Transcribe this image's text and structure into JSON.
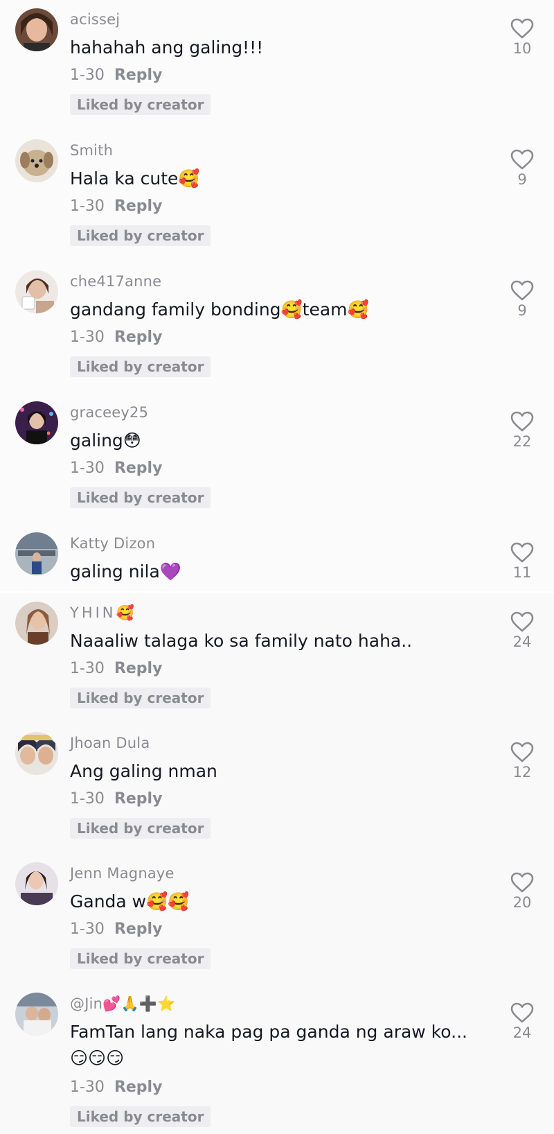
{
  "comments": [
    {
      "username": "acissej",
      "text": "hahahah ang galing!!!",
      "date": "1-30",
      "reply": "Reply",
      "badge": "Liked by creator",
      "likes": "10",
      "avatar_color": "#6b4a3a"
    },
    {
      "username": "Smith",
      "text": "Hala ka cute🥰",
      "date": "1-30",
      "reply": "Reply",
      "badge": "Liked by creator",
      "likes": "9",
      "avatar_color": "#c9b08f"
    },
    {
      "username": "che417anne",
      "text": "gandang family bonding🥰team🥰",
      "date": "1-30",
      "reply": "Reply",
      "badge": "Liked by creator",
      "likes": "9",
      "avatar_color": "#d8c7c0"
    },
    {
      "username": "graceey25",
      "text": "galing😳",
      "date": "1-30",
      "reply": "Reply",
      "badge": "Liked by creator",
      "likes": "22",
      "avatar_color": "#3a1f4a"
    },
    {
      "username": "Katty Dizon",
      "text": "galing nila💜",
      "likes": "11",
      "avatar_color": "#6f7f8f"
    },
    {
      "username": "YHIN🥰",
      "text": "Naaaliw talaga ko sa family nato haha..",
      "date": "1-30",
      "reply": "Reply",
      "badge": "Liked by creator",
      "likes": "24",
      "avatar_color": "#8c5a3c"
    },
    {
      "username": "Jhoan Dula",
      "text": "Ang galing nman",
      "date": "1-30",
      "reply": "Reply",
      "badge": "Liked by creator",
      "likes": "12",
      "avatar_color": "#3b3b4f"
    },
    {
      "username": "Jenn Magnaye",
      "text": "Ganda w🥰🥰",
      "date": "1-30",
      "reply": "Reply",
      "badge": "Liked by creator",
      "likes": "20",
      "avatar_color": "#4a3a55"
    },
    {
      "username": "@Jin💕🙏➕⭐",
      "text": "FamTan lang naka pag pa ganda ng araw ko...",
      "text2": "😏😏😏",
      "date": "1-30",
      "reply": "Reply",
      "badge": "Liked by creator",
      "likes": "24",
      "avatar_color": "#7a8a9a"
    }
  ]
}
